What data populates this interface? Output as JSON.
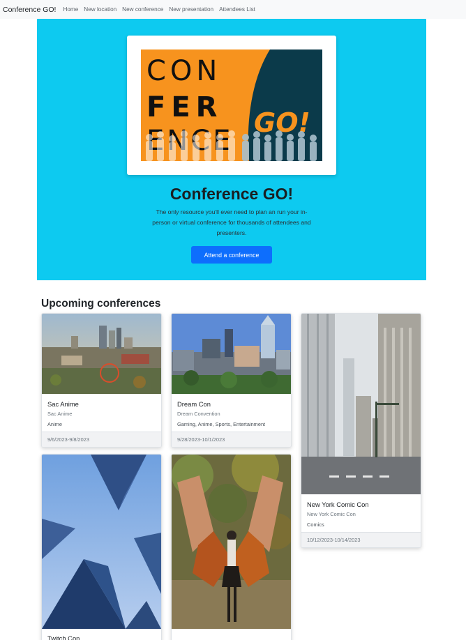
{
  "navbar": {
    "brand": "Conference GO!",
    "links": [
      "Home",
      "New location",
      "New conference",
      "New presentation",
      "Attendees List"
    ]
  },
  "hero": {
    "logo_text": {
      "line1": "CON",
      "line2": "FER",
      "line3": "ENCE",
      "go": "GO!"
    },
    "title": "Conference GO!",
    "lead_lines": [
      "The only resource you'll ever need to plan an run your in-",
      "person or virtual conference for thousands of attendees and",
      "presenters."
    ],
    "button_label": "Attend a conference"
  },
  "section_title": "Upcoming conferences",
  "conferences": [
    {
      "title": "Sac Anime",
      "subtitle": "Sac Anime",
      "description": "Anime",
      "dates": "9/6/2023-9/8/2023"
    },
    {
      "title": "Dream Con",
      "subtitle": "Dream Convention",
      "description": "Gaming, Anime, Sports, Entertainment",
      "dates": "9/28/2023-10/1/2023"
    },
    {
      "title": "New York Comic Con",
      "subtitle": "New York Comic Con",
      "description": "Comics",
      "dates": "10/12/2023-10/14/2023"
    },
    {
      "title": "Twitch Con"
    }
  ],
  "colors": {
    "hero_bg": "#0dcaf0",
    "primary_button": "#0d6efd",
    "logo_orange": "#f7931e",
    "logo_navy": "#0b3a4a"
  }
}
